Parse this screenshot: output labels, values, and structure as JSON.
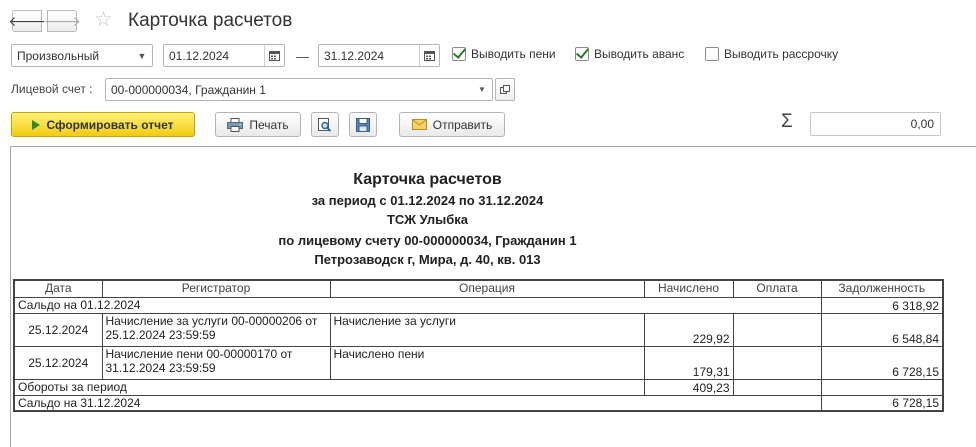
{
  "window": {
    "title": "Карточка расчетов"
  },
  "filters": {
    "period_type": "Произвольный",
    "date_from": "01.12.2024",
    "date_to": "31.12.2024",
    "separator": "—",
    "show_penalty": {
      "label": "Выводить пени",
      "checked": true
    },
    "show_advance": {
      "label": "Выводить аванс",
      "checked": true
    },
    "show_installment": {
      "label": "Выводить рассрочку",
      "checked": false
    },
    "account_label": "Лицевой счет :",
    "account_value": "00-000000034, Гражданин 1"
  },
  "toolbar": {
    "generate_label": "Сформировать отчет",
    "print_label": "Печать",
    "send_label": "Отправить",
    "sigma": "Σ",
    "sum_value": "0,00"
  },
  "report": {
    "title": "Карточка расчетов",
    "period": "за период с 01.12.2024 по 31.12.2024",
    "organization": "ТСЖ Улыбка",
    "account": "по лицевому счету 00-000000034, Гражданин 1",
    "address": "Петрозаводск г, Мира, д. 40, кв. 013",
    "columns": {
      "date": "Дата",
      "registrar": "Регистратор",
      "operation": "Операция",
      "accrued": "Начислено",
      "payment": "Оплата",
      "debt": "Задолженность"
    },
    "opening": {
      "label": "Сальдо на 01.12.2024",
      "debt": "6 318,92"
    },
    "rows": [
      {
        "date": "25.12.2024",
        "registrar": "Начисление за услуги 00-00000206 от 25.12.2024 23:59:59",
        "operation": "Начисление за услуги",
        "accrued": "229,92",
        "payment": "",
        "debt": "6 548,84"
      },
      {
        "date": "25.12.2024",
        "registrar": "Начисление пени 00-00000170 от 31.12.2024 23:59:59",
        "operation": "Начислено пени",
        "accrued": "179,31",
        "payment": "",
        "debt": "6 728,15"
      }
    ],
    "turnover": {
      "label": "Обороты за период",
      "accrued": "409,23"
    },
    "closing": {
      "label": "Сальдо на 31.12.2024",
      "debt": "6 728,15"
    }
  }
}
